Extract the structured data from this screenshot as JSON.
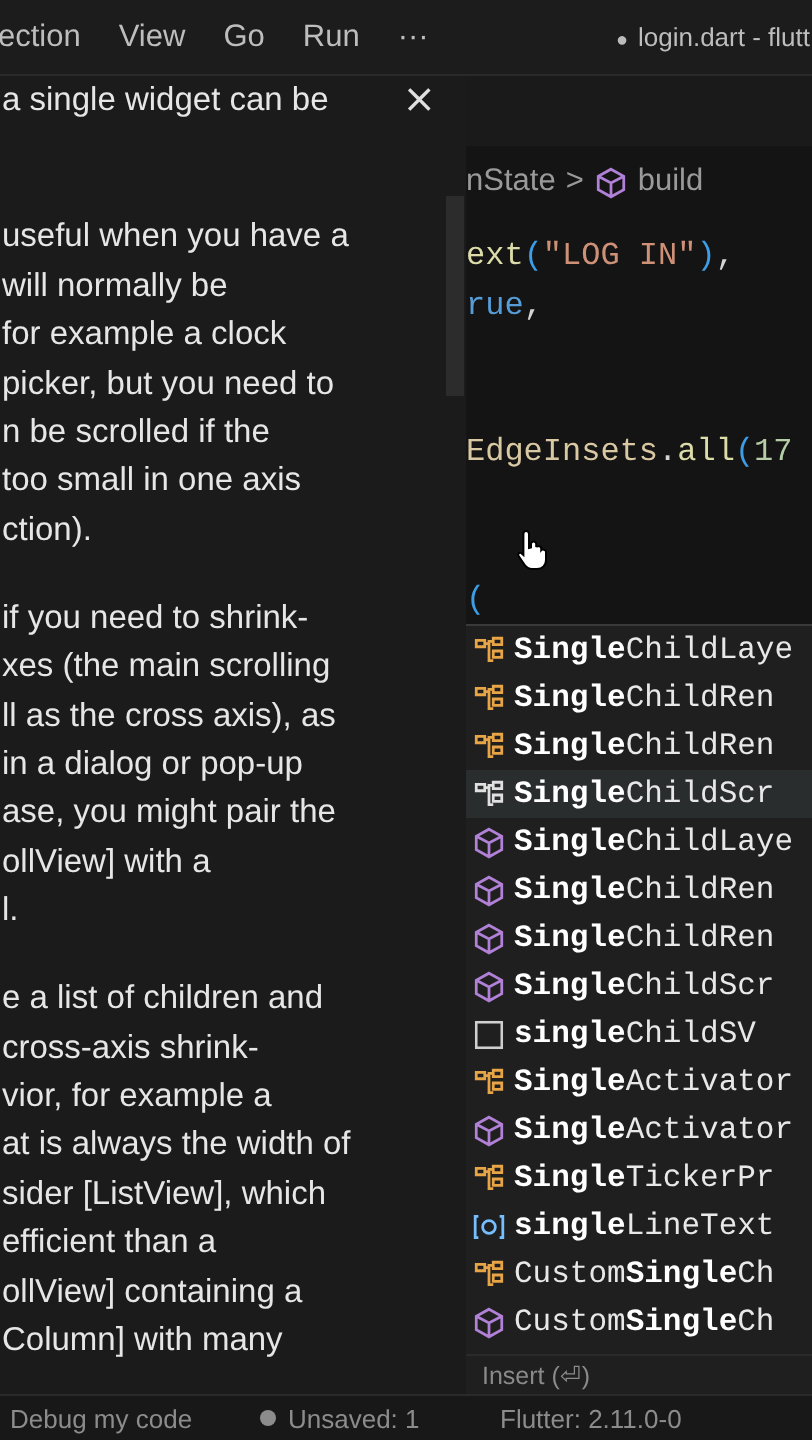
{
  "menu_bar": {
    "items": [
      "ection",
      "View",
      "Go",
      "Run",
      "···"
    ],
    "title_dot": "●",
    "title": "login.dart - flutt"
  },
  "doc_panel": {
    "close": "×",
    "paragraphs": [
      [
        "a single widget can be"
      ],
      [
        "useful when you have a",
        "will normally be",
        "for example a clock",
        "picker, but you need to",
        "n be scrolled if the",
        "too small in one axis",
        "ction)."
      ],
      [
        "if you need to shrink-",
        "xes (the main scrolling",
        "ll as the cross axis), as",
        "in a dialog or pop-up",
        "ase, you might pair the",
        "ollView] with a",
        "l."
      ],
      [
        "e a list of children and",
        "cross-axis shrink-",
        "vior, for example a",
        "at is always the width of",
        "sider [ListView], which",
        "efficient than a",
        "ollView] containing a",
        "Column] with many"
      ]
    ]
  },
  "breadcrumb": {
    "parent": "nState",
    "separator": ">",
    "current": "build"
  },
  "code_lines": [
    {
      "kind": "code",
      "tokens": [
        {
          "kind": "fn",
          "text": "ext"
        },
        {
          "kind": "paren",
          "text": "("
        },
        {
          "kind": "str",
          "text": "\"LOG IN\""
        },
        {
          "kind": "paren",
          "text": ")"
        },
        {
          "kind": "punct",
          "text": ","
        }
      ]
    },
    {
      "kind": "code",
      "tokens": [
        {
          "kind": "kw",
          "text": "rue"
        },
        {
          "kind": "punct",
          "text": ","
        }
      ]
    },
    {
      "kind": "blank"
    },
    {
      "kind": "blank"
    },
    {
      "kind": "code",
      "tokens": [
        {
          "kind": "cls",
          "text": "EdgeInsets"
        },
        {
          "kind": "punct",
          "text": "."
        },
        {
          "kind": "fn",
          "text": "all"
        },
        {
          "kind": "paren",
          "text": "("
        },
        {
          "kind": "num",
          "text": "17"
        }
      ]
    },
    {
      "kind": "blank"
    },
    {
      "kind": "blank"
    },
    {
      "kind": "code",
      "tokens": [
        {
          "kind": "paren",
          "text": "("
        }
      ]
    }
  ],
  "suggestions": {
    "items": [
      {
        "kind": "class",
        "label": "**Single**ChildLaye",
        "selected": false
      },
      {
        "kind": "class",
        "label": "**Single**ChildRen",
        "selected": false
      },
      {
        "kind": "class",
        "label": "**Single**ChildRen",
        "selected": false
      },
      {
        "kind": "class",
        "label": "**Single**ChildScr",
        "selected": true
      },
      {
        "kind": "constructor",
        "label": "**Single**ChildLaye",
        "selected": false
      },
      {
        "kind": "constructor",
        "label": "**Single**ChildRen",
        "selected": false
      },
      {
        "kind": "constructor",
        "label": "**Single**ChildRen",
        "selected": false
      },
      {
        "kind": "constructor",
        "label": "**Single**ChildScr",
        "selected": false
      },
      {
        "kind": "snippet",
        "label": "**single**ChildSV",
        "selected": false
      },
      {
        "kind": "class",
        "label": "**Single**Activator",
        "selected": false
      },
      {
        "kind": "constructor",
        "label": "**Single**Activator",
        "selected": false
      },
      {
        "kind": "class",
        "label": "**Single**TickerPr",
        "selected": false
      },
      {
        "kind": "variable",
        "label": "**single**LineText",
        "selected": false
      },
      {
        "kind": "class",
        "label": "Custom**Single**Ch",
        "selected": false
      },
      {
        "kind": "constructor",
        "label": "Custom**Single**Ch",
        "selected": false
      }
    ],
    "footer": "Insert (⏎)"
  },
  "status_bar": {
    "debug": "Debug my code",
    "unsaved": "Unsaved: 1",
    "flutter": "Flutter: 2.11.0-0"
  }
}
